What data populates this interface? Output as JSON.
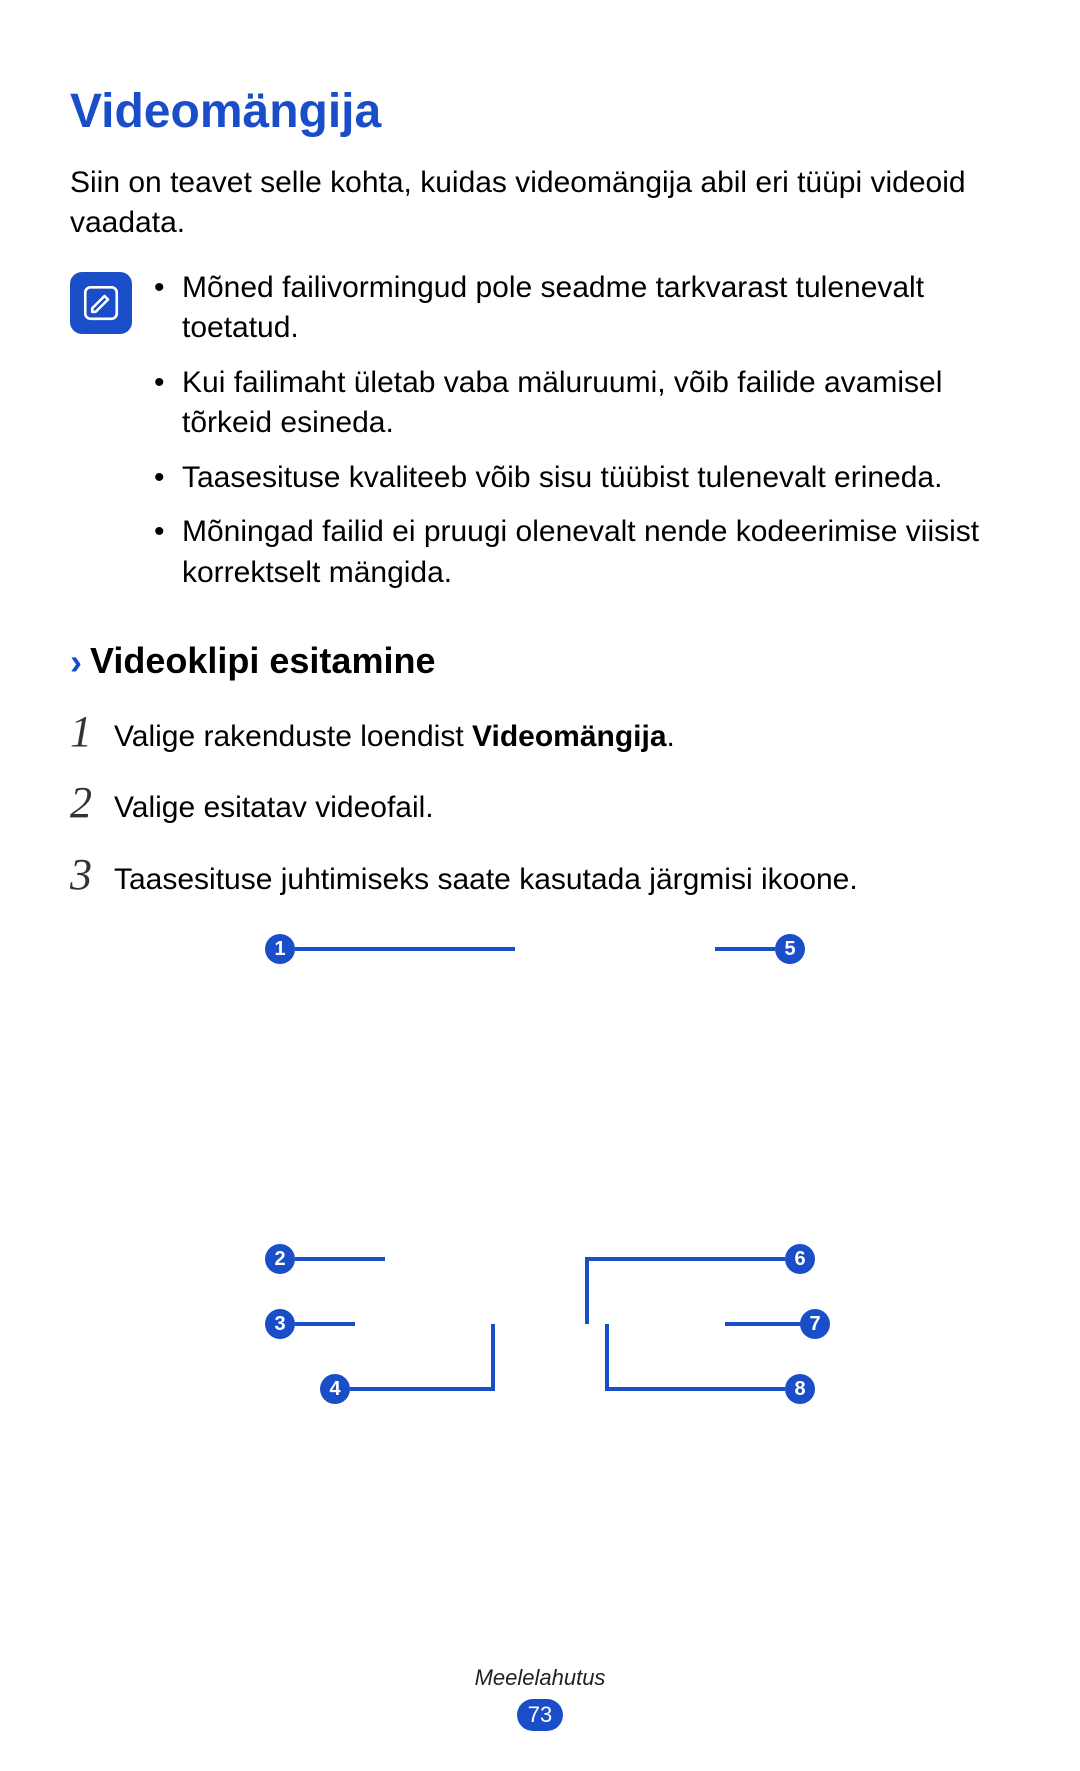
{
  "title": "Videomängija",
  "intro": "Siin on teavet selle kohta, kuidas videomängija abil eri tüüpi videoid vaadata.",
  "note_icon": "note-icon",
  "notes": [
    "Mõned failivormingud pole seadme tarkvarast tulenevalt toetatud.",
    "Kui failimaht ületab vaba mäluruumi, võib failide avamisel tõrkeid esineda.",
    "Taasesituse kvaliteeb võib sisu tüübist tulenevalt erineda.",
    "Mõningad failid ei pruugi olenevalt nende kodeerimise viisist korrektselt mängida."
  ],
  "subheading": "Videoklipi esitamine",
  "steps": {
    "s1_prefix": "Valige rakenduste loendist ",
    "s1_bold": "Videomängija",
    "s1_suffix": ".",
    "s2": "Valige esitatav videofail.",
    "s3": "Taasesituse juhtimiseks saate kasutada järgmisi ikoone."
  },
  "callouts": {
    "c1": "1",
    "c2": "2",
    "c3": "3",
    "c4": "4",
    "c5": "5",
    "c6": "6",
    "c7": "7",
    "c8": "8"
  },
  "footer": {
    "section": "Meelelahutus",
    "page": "73"
  }
}
